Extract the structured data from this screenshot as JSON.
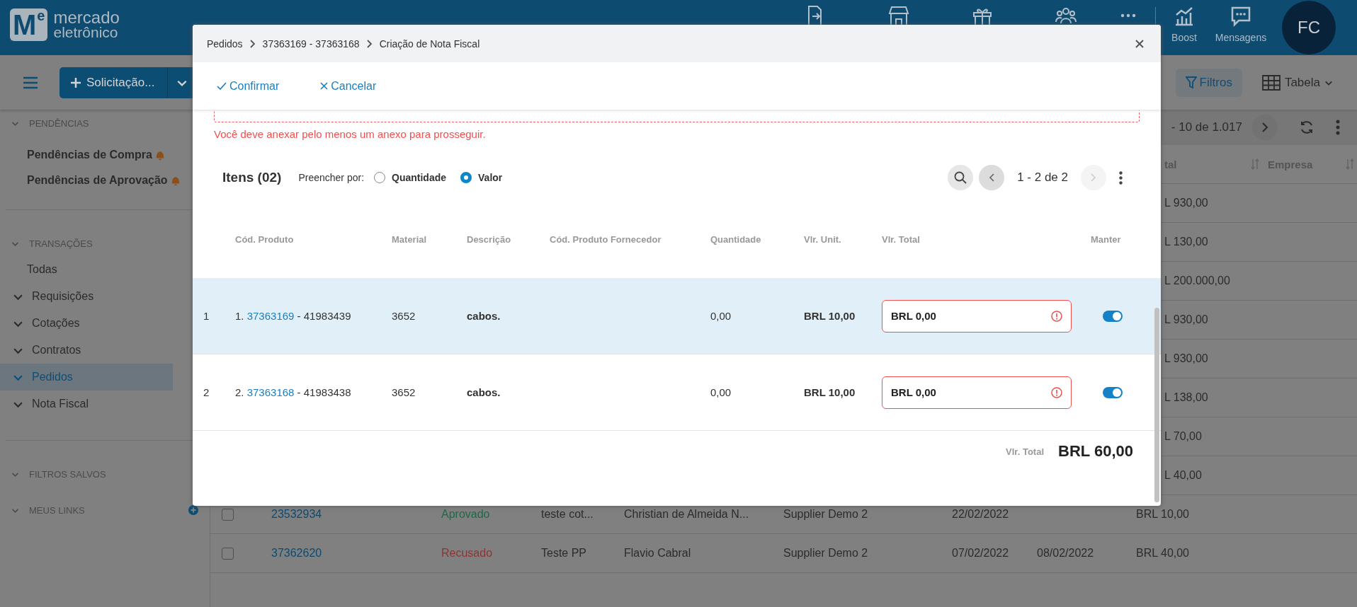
{
  "header": {
    "logo": {
      "mark": "M",
      "mark_sup": "e",
      "line_1": "mercado",
      "line_2": "eletrônico"
    },
    "boost_label": "Boost",
    "messages_label": "Mensagens",
    "avatar": "FC"
  },
  "toolbar": {
    "new_button": "Solicitação...",
    "filters_button": "Filtros",
    "view_button": "Tabela"
  },
  "sidebar": {
    "sections": [
      {
        "title": "PENDÊNCIAS",
        "items": [
          {
            "label": "Pendências de Compra",
            "kind": "pending",
            "selected": false
          },
          {
            "label": "Pendências de Aprovação",
            "kind": "pending",
            "selected": false
          }
        ]
      },
      {
        "title": "TRANSAÇÕES",
        "items": [
          {
            "label": "Todas",
            "kind": "link",
            "selected": false
          },
          {
            "label": "Requisições",
            "kind": "group",
            "selected": false
          },
          {
            "label": "Cotações",
            "kind": "group",
            "selected": false
          },
          {
            "label": "Contratos",
            "kind": "group",
            "selected": false
          },
          {
            "label": "Pedidos",
            "kind": "group",
            "selected": true
          },
          {
            "label": "Nota Fiscal",
            "kind": "group",
            "selected": false
          }
        ]
      },
      {
        "title": "FILTROS SALVOS"
      },
      {
        "title": "MEUS LINKS",
        "kind": "links"
      }
    ]
  },
  "list": {
    "pagination": "- 10 de 1.017",
    "columns": [
      "tal",
      "Empresa"
    ],
    "rows": [
      {
        "total": "L 930,00"
      },
      {
        "total": "L 130,00"
      },
      {
        "total": "L 200.000,00"
      },
      {
        "total": "L 930,00"
      },
      {
        "total": "L 930,00"
      },
      {
        "total": "L 138,00"
      },
      {
        "total": "L 70,00"
      },
      {
        "total": "L 40,00"
      },
      {
        "checked": false,
        "order_number": "23532934",
        "status": "Aprovado",
        "color": "#1b6a47",
        "title": "teste cot...",
        "requester": "Christian de Almeida N...",
        "supplier": "Supplier Demo 2",
        "date_1": "22/02/2022",
        "total": "BRL 10,00"
      },
      {
        "checked": false,
        "order_number": "37362620",
        "status": "Recusado",
        "color": "#8c3434",
        "title": "Teste PP",
        "requester": "Flavio Cabral",
        "supplier": "Supplier Demo 2",
        "date_1": "07/02/2022",
        "date_2": "08/02/2022",
        "total": "BRL 40,00"
      }
    ]
  },
  "modal": {
    "breadcrumb": [
      "Pedidos",
      "37363169 - 37363168",
      "Criação de Nota Fiscal"
    ],
    "actions": [
      {
        "label": "Confirmar",
        "kind": "confirm"
      },
      {
        "label": "Cancelar",
        "kind": "cancel"
      }
    ],
    "upload_error": "Você deve anexar pelo menos um anexo para prosseguir.",
    "items_title": "Itens (02)",
    "fill_label": "Preencher por:",
    "fill_options": [
      {
        "label": "Quantidade",
        "selected": false
      },
      {
        "label": "Valor",
        "selected": true
      }
    ],
    "pagination": "1 - 2 de 2",
    "prev_disabled": false,
    "next_disabled": true,
    "columns": [
      "Cód. Produto",
      "Material",
      "Descrição",
      "Cód. Produto Fornecedor",
      "Quantidade",
      "Vlr. Unit.",
      "Vlr. Total",
      "Manter"
    ],
    "rows": [
      {
        "index": "1",
        "prefix": "1.",
        "order": "37363169",
        "suffix": "- 41983439",
        "material": "3652",
        "description": "cabos.",
        "quantity": "0,00",
        "unit_price": "BRL 10,00",
        "total": "BRL 0,00",
        "total_invalid": true,
        "keep": true,
        "selected": true
      },
      {
        "index": "2",
        "prefix": "2.",
        "order": "37363168",
        "suffix": "- 41983438",
        "material": "3652",
        "description": "cabos.",
        "quantity": "0,00",
        "unit_price": "BRL 10,00",
        "total": "BRL 0,00",
        "total_invalid": true,
        "keep": true,
        "selected": false
      }
    ],
    "total_label": "Vlr. Total",
    "total_value": "BRL 60,00"
  }
}
